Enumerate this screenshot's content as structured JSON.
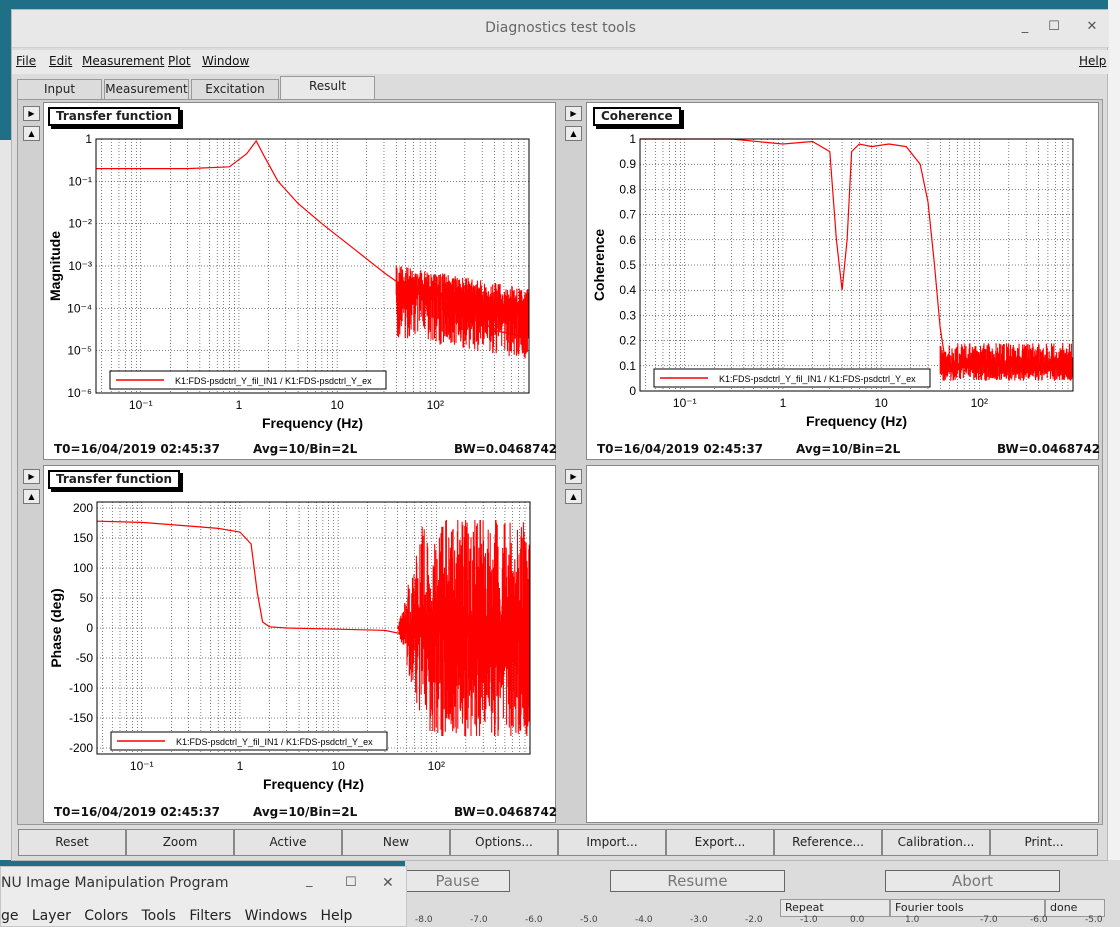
{
  "window": {
    "title": "Diagnostics test tools",
    "minimize": "_",
    "maximize": "☐",
    "close": "✕"
  },
  "menu": {
    "file": "File",
    "edit": "Edit",
    "measurement": "Measurement",
    "plot": "Plot",
    "window": "Window",
    "help": "Help"
  },
  "tabs": [
    {
      "label": "Input"
    },
    {
      "label": "Measurement"
    },
    {
      "label": "Excitation"
    },
    {
      "label": "Result",
      "active": true
    }
  ],
  "nav": {
    "right": "▶",
    "up": "▲"
  },
  "plots": [
    {
      "title": "Transfer function",
      "ylabel": "Magnitude",
      "xlabel": "Frequency (Hz)",
      "legend": "K1:FDS-psdctrl_Y_fil_IN1 / K1:FDS-psdctrl_Y_ex",
      "t0": "T0=16/04/2019 02:45:37",
      "avg": "Avg=10/Bin=2L",
      "bw": "BW=0.0468742"
    },
    {
      "title": "Coherence",
      "ylabel": "Coherence",
      "xlabel": "Frequency (Hz)",
      "legend": "K1:FDS-psdctrl_Y_fil_IN1 / K1:FDS-psdctrl_Y_ex",
      "t0": "T0=16/04/2019 02:45:37",
      "avg": "Avg=10/Bin=2L",
      "bw": "BW=0.0468742"
    },
    {
      "title": "Transfer function",
      "ylabel": "Phase (deg)",
      "xlabel": "Frequency (Hz)",
      "legend": "K1:FDS-psdctrl_Y_fil_IN1 / K1:FDS-psdctrl_Y_ex",
      "t0": "T0=16/04/2019 02:45:37",
      "avg": "Avg=10/Bin=2L",
      "bw": "BW=0.0468742"
    }
  ],
  "toolbar": {
    "reset": "Reset",
    "zoom": "Zoom",
    "active": "Active",
    "new": "New",
    "options": "Options...",
    "import": "Import...",
    "export": "Export...",
    "reference": "Reference...",
    "calibration": "Calibration...",
    "print": "Print..."
  },
  "behind": {
    "pause": "Pause",
    "resume": "Resume",
    "abort": "Abort",
    "repeat": "Repeat",
    "fourier": "Fourier tools",
    "done": "done",
    "axis_ticks": [
      "-8.0",
      "-7.0",
      "-6.0",
      "-5.0",
      "-4.0",
      "-3.0",
      "-2.0",
      "-1.0",
      "0.0",
      "1.0",
      "-7.0",
      "-6.0",
      "-5.0"
    ]
  },
  "gimp": {
    "title": "NU Image Manipulation Program",
    "menus": [
      "ge",
      "Layer",
      "Colors",
      "Tools",
      "Filters",
      "Windows",
      "Help"
    ]
  },
  "chart_data": [
    {
      "type": "line",
      "title": "Transfer function",
      "xlabel": "Frequency (Hz)",
      "ylabel": "Magnitude",
      "xscale": "log",
      "yscale": "log",
      "xlim": [
        0.035,
        900
      ],
      "ylim": [
        1e-06,
        1
      ],
      "xticks": [
        "10⁻¹",
        "1",
        "10",
        "10²"
      ],
      "yticks": [
        "1",
        "10⁻¹",
        "10⁻²",
        "10⁻³",
        "10⁻⁴",
        "10⁻⁵",
        "10⁻⁶"
      ],
      "grid": true,
      "legend_position": "bottom-left",
      "color": "#ff0000",
      "series": [
        {
          "name": "K1:FDS-psdctrl_Y_fil_IN1 / K1:FDS-psdctrl_Y_ex",
          "x": [
            0.035,
            0.1,
            0.3,
            0.8,
            1.2,
            1.5,
            1.8,
            2.5,
            4,
            7,
            15,
            30,
            50,
            100,
            200,
            400,
            900
          ],
          "y": [
            0.2,
            0.2,
            0.2,
            0.22,
            0.45,
            0.9,
            0.4,
            0.1,
            0.03,
            0.01,
            0.0025,
            0.0007,
            0.0003,
            0.00015,
            0.0001,
            3e-05,
            2e-05
          ]
        }
      ]
    },
    {
      "type": "line",
      "title": "Coherence",
      "xlabel": "Frequency (Hz)",
      "ylabel": "Coherence",
      "xscale": "log",
      "xlim": [
        0.035,
        900
      ],
      "ylim": [
        0,
        1
      ],
      "xticks": [
        "10⁻¹",
        "1",
        "10",
        "10²"
      ],
      "yticks": [
        "0",
        "0.1",
        "0.2",
        "0.3",
        "0.4",
        "0.5",
        "0.6",
        "0.7",
        "0.8",
        "0.9",
        "1"
      ],
      "grid": true,
      "legend_position": "bottom-left",
      "color": "#ff0000",
      "series": [
        {
          "name": "K1:FDS-psdctrl_Y_fil_IN1 / K1:FDS-psdctrl_Y_ex",
          "x": [
            0.035,
            0.3,
            1,
            2,
            3,
            3.5,
            4,
            4.5,
            5,
            6,
            8,
            12,
            18,
            25,
            30,
            35,
            40,
            45,
            50,
            80,
            200,
            900
          ],
          "y": [
            1,
            1,
            0.98,
            0.99,
            0.95,
            0.6,
            0.4,
            0.6,
            0.95,
            0.98,
            0.97,
            0.98,
            0.97,
            0.9,
            0.75,
            0.5,
            0.25,
            0.12,
            0.08,
            0.1,
            0.12,
            0.1
          ]
        }
      ]
    },
    {
      "type": "line",
      "title": "Transfer function",
      "xlabel": "Frequency (Hz)",
      "ylabel": "Phase (deg)",
      "xscale": "log",
      "xlim": [
        0.035,
        900
      ],
      "ylim": [
        -210,
        210
      ],
      "xticks": [
        "10⁻¹",
        "1",
        "10",
        "10²"
      ],
      "yticks": [
        "200",
        "150",
        "100",
        "50",
        "0",
        "-50",
        "-100",
        "-150",
        "-200"
      ],
      "grid": true,
      "legend_position": "bottom-left",
      "color": "#ff0000",
      "series": [
        {
          "name": "K1:FDS-psdctrl_Y_fil_IN1 / K1:FDS-psdctrl_Y_ex",
          "x": [
            0.035,
            0.1,
            0.3,
            0.6,
            1.0,
            1.3,
            1.5,
            1.7,
            2.0,
            3,
            10,
            30,
            45,
            60,
            100,
            300,
            900
          ],
          "y": [
            178,
            176,
            170,
            166,
            160,
            140,
            60,
            10,
            2,
            0,
            -2,
            -4,
            -10,
            0,
            0,
            0,
            0
          ]
        }
      ]
    }
  ]
}
